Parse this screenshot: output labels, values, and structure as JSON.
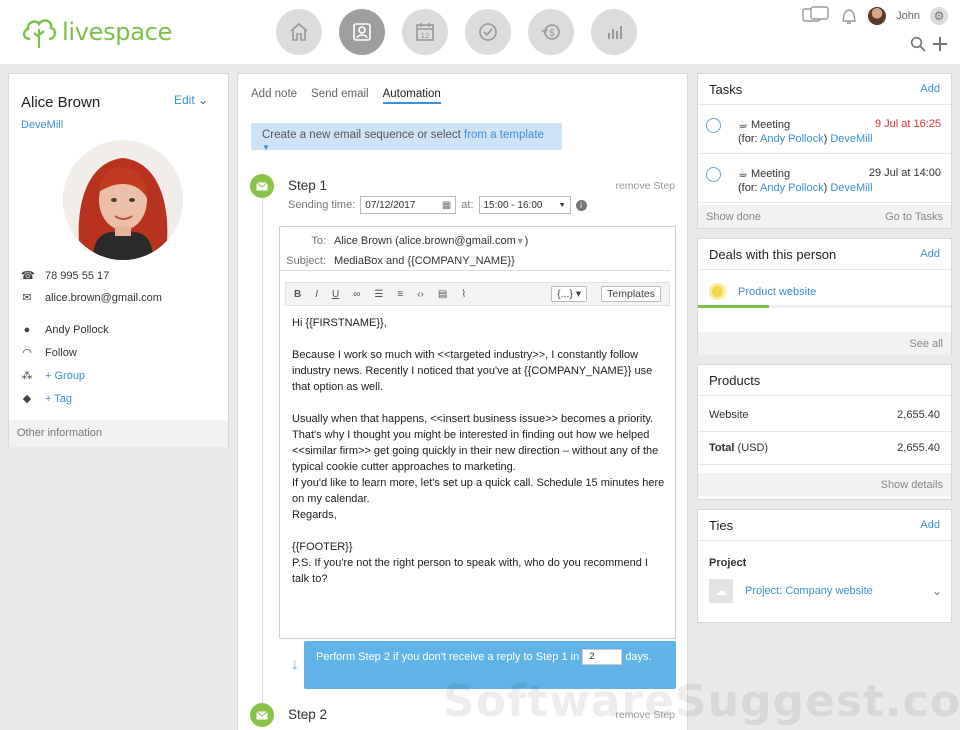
{
  "app": {
    "logo_text": "livespace",
    "brand_color": "#7cc04a",
    "accent_color": "#3d8fd6"
  },
  "nav": {
    "icons": [
      "home-icon",
      "contacts-icon",
      "calendar-icon",
      "tasks-icon",
      "money-icon",
      "reports-icon"
    ],
    "calendar_day": "12",
    "active": "contacts-icon"
  },
  "user": {
    "name": "John"
  },
  "contact": {
    "name": "Alice Brown",
    "edit_label": "Edit",
    "company": "DeveMill",
    "phone": "78 995 55 17",
    "email": "alice.brown@gmail.com",
    "owner": "Andy Pollock",
    "follow_label": "Follow",
    "group_label": "+ Group",
    "tag_label": "+ Tag",
    "other_info_label": "Other information"
  },
  "middle": {
    "tabs": [
      "Add note",
      "Send email",
      "Automation"
    ],
    "active_tab": "Automation",
    "sequence_prefix": "Create a new email sequence or select",
    "sequence_link": "from a template",
    "step1": {
      "title": "Step 1",
      "remove": "remove Step",
      "sending_label": "Sending time:",
      "date": "07/12/2017",
      "at_label": "at:",
      "time": "15:00 - 16:00",
      "to_label": "To:",
      "to_value": "Alice Brown   (alice.brown@gmail.com",
      "subject_label": "Subject:",
      "subject_value": "MediaBox and {{COMPANY_NAME}}",
      "toolbar": [
        "B",
        "I",
        "U"
      ],
      "vars_label": "{...}",
      "templates_label": "Templates",
      "body": [
        "Hi {{FIRSTNAME}},",
        "",
        "Because I work so much with <<targeted industry>>, I constantly follow industry news. Recently I noticed that you've at {{COMPANY_NAME}} use that option as well.",
        "",
        "Usually when that happens, <<insert business issue>> becomes a priority. That's why I thought you might be interested in finding out how we helped <<similar firm>> get going quickly in their new direction – without any of the typical cookie cutter approaches to marketing.",
        " If you'd like to learn more, let's set up a quick call. Schedule 15 minutes here on my calendar.",
        "Regards,",
        "",
        "{{FOOTER}}",
        "P.S. If you're not the right person to speak with, who do you recommend I talk to?"
      ]
    },
    "perform": {
      "text_before": "Perform Step 2 if you don't receive a reply to Step 1 in",
      "days": "2",
      "text_after": "days."
    },
    "step2": {
      "title": "Step 2",
      "remove": "remove Step"
    },
    "watermark": "SoftwareSuggest.com"
  },
  "tasks": {
    "title": "Tasks",
    "add": "Add",
    "items": [
      {
        "title": "Meeting",
        "date": "9 Jul at 16:25",
        "overdue": true,
        "for_prefix": "(for:",
        "person": "Andy Pollock",
        "close": ")",
        "company": "DeveMill"
      },
      {
        "title": "Meeting",
        "date": "29 Jul at 14:00",
        "overdue": false,
        "for_prefix": "(for:",
        "person": "Andy Pollock",
        "close": ")",
        "company": "DeveMill"
      }
    ],
    "show_done": "Show done",
    "go_to": "Go to Tasks"
  },
  "deals": {
    "title": "Deals with this person",
    "add": "Add",
    "deal": "Product website",
    "progress": 0.28,
    "see_all": "See all"
  },
  "products": {
    "title": "Products",
    "rows": [
      {
        "label": "Website",
        "value": "2,655.40"
      }
    ],
    "total_label": "Total",
    "total_currency": "(USD)",
    "total_value": "2,655.40",
    "show_details": "Show details"
  },
  "ties": {
    "title": "Ties",
    "add": "Add",
    "section": "Project",
    "project": "Project: Company website"
  }
}
